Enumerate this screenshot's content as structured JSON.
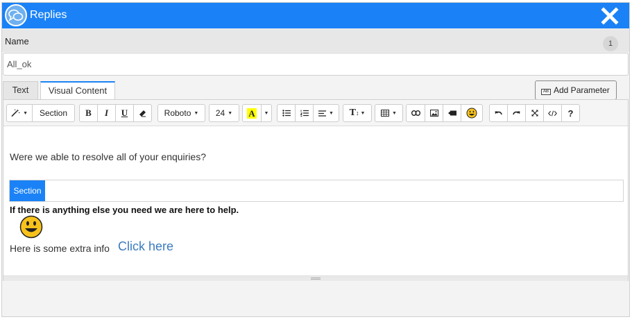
{
  "dialog": {
    "title": "Replies",
    "name_label": "Name",
    "count": "1",
    "name_value": "All_ok"
  },
  "tabs": [
    {
      "label": "Text",
      "active": false
    },
    {
      "label": "Visual Content",
      "active": true
    }
  ],
  "add_parameter_label": "Add Parameter",
  "add_parameter_badge": "AB",
  "toolbar": {
    "magic_icon": "magic-wand-icon",
    "section_label": "Section",
    "bold": "B",
    "italic": "I",
    "underline": "U",
    "font_name": "Roboto",
    "font_size": "24",
    "highlight_letter": "A",
    "text_size_label": "T",
    "help": "?",
    "icons": [
      "eraser-icon",
      "unordered-list-icon",
      "ordered-list-icon",
      "align-icon",
      "table-icon",
      "link-icon",
      "image-icon",
      "video-icon",
      "emoji-icon",
      "undo-icon",
      "redo-icon",
      "fullscreen-icon",
      "code-view-icon"
    ]
  },
  "content": {
    "line1": "Were we able to resolve all of your enquiries?",
    "section_badge": "Section",
    "bold_line": "If there is anything else you need we are here to help.",
    "extra_text": "Here is some extra info",
    "link_text": "Click here"
  },
  "colors": {
    "accent": "#1a82f6",
    "highlight_yellow": "#ffff00",
    "link": "#3a7bbf"
  }
}
